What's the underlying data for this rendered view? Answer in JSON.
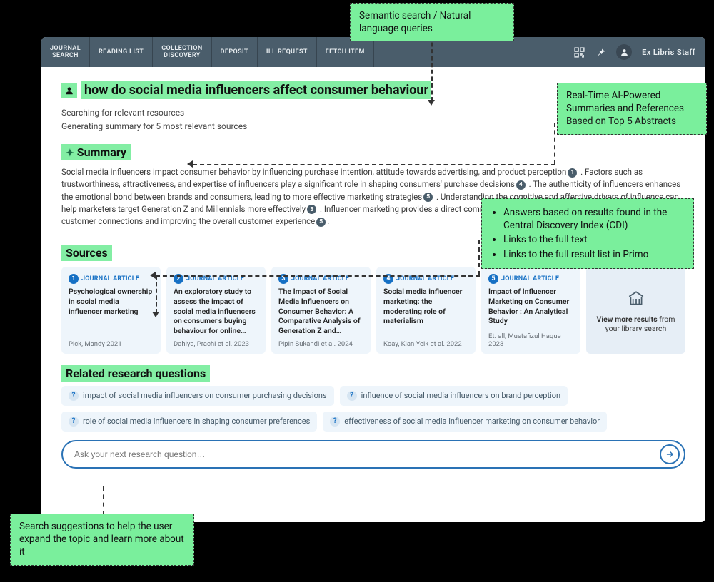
{
  "nav": {
    "items": [
      "JOURNAL SEARCH",
      "READING LIST",
      "COLLECTION DISCOVERY",
      "DEPOSIT",
      "ILL REQUEST",
      "FETCH ITEM"
    ],
    "user": "Ex Libris Staff"
  },
  "query": "how do social media influencers affect consumer behaviour",
  "status": {
    "l1": "Searching for relevant resources",
    "l2": "Generating summary for 5 most relevant sources"
  },
  "summary_heading": "Summary",
  "summary": {
    "s1a": "Social media influencers impact consumer behavior by influencing purchase intention, attitude towards advertising, and product perception",
    "s1b": ". Factors such as trustworthiness, attractiveness, and expertise of influencers play a significant role in shaping consumers' purchase decisions",
    "s1c": ". The authenticity of influencers enhances the emotional bond between brands and consumers, leading to more effective marketing strategies",
    "s1d": ". Understanding the cognitive and affective drivers of influence can help marketers target Generation Z and Millennials more effectively",
    "s1e": ". Influencer marketing provides a direct communication channel to consumers, strengthening customer connections and improving the overall customer experience",
    "full_dot": "."
  },
  "sources_heading": "Sources",
  "sources_type_label": "JOURNAL ARTICLE",
  "sources": [
    {
      "n": "1",
      "title": "Psychological ownership in social media influencer marketing",
      "meta": "Pick, Mandy 2021"
    },
    {
      "n": "2",
      "title": "An exploratory study to assess the impact of social media influencers on consumer's buying behaviour for online…",
      "meta": "Dahiya, Prachi et al. 2023"
    },
    {
      "n": "3",
      "title": "The Impact of Social Media Influencers on Consumer Behavior: A Comparative Analysis of Generation Z and…",
      "meta": "Pipin Sukandi et al. 2024"
    },
    {
      "n": "4",
      "title": "Social media influencer marketing: the moderating role of materialism",
      "meta": "Koay, Kian Yeik et al. 2022"
    },
    {
      "n": "5",
      "title": "Impact of Influencer Marketing on Consumer Behavior : An Analytical Study",
      "meta": "Et. all, Mustafizul Haque 2023"
    }
  ],
  "view_more": {
    "bold": "View more results",
    "rest": " from your library search"
  },
  "related_heading": "Related research questions",
  "related": [
    "impact of social media influencers on consumer purchasing decisions",
    "influence of social media influencers on brand perception",
    "role of social media influencers in shaping consumer preferences",
    "effectiveness of social media influencer marketing on consumer behavior"
  ],
  "ask_placeholder": "Ask your next research question…",
  "callouts": {
    "c1": "Semantic search / Natural language queries",
    "c2_l1": "Real-Time AI-Powered Summaries and References",
    "c2_l2": "Based on Top 5 Abstracts",
    "c3_items": [
      "Answers based on results found in the Central Discovery Index (CDI)",
      "Links to the full text",
      "Links to the full result list in Primo"
    ],
    "c4": "Search suggestions to help the user expand the topic and learn more about it"
  }
}
